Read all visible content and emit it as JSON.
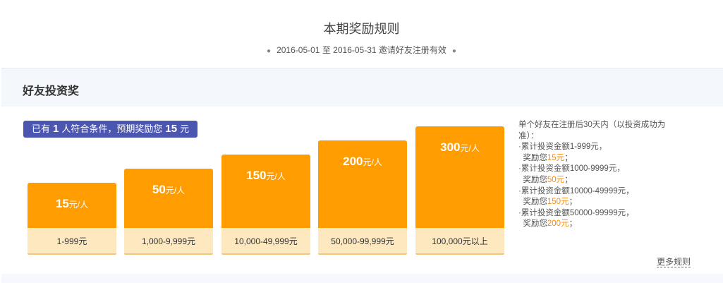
{
  "header": {
    "title": "本期奖励规则",
    "period_start": "2016-05-01",
    "period_sep": "至",
    "period_end": "2016-05-31",
    "period_note": "邀请好友注册有效"
  },
  "section": {
    "title": "好友投资奖",
    "summary_prefix": "已有",
    "summary_count": "1",
    "summary_mid": "人符合条件，预期奖励您",
    "summary_amount": "15",
    "summary_suffix": "元"
  },
  "tiers": [
    {
      "reward": "15",
      "unit": "元/人",
      "range": "1-999元"
    },
    {
      "reward": "50",
      "unit": "元/人",
      "range": "1,000-9,999元"
    },
    {
      "reward": "150",
      "unit": "元/人",
      "range": "10,000-49,999元"
    },
    {
      "reward": "200",
      "unit": "元/人",
      "range": "50,000-99,999元"
    },
    {
      "reward": "300",
      "unit": "元/人",
      "range": "100,000元以上"
    }
  ],
  "rules": {
    "intro_1": "单个好友在注册后30天内（以投资成功为",
    "intro_2": "准）：",
    "items": [
      {
        "cond": "·累计投资金额1-999元，",
        "prefix": "奖励您",
        "amount": "15元",
        "suffix": "；"
      },
      {
        "cond": "·累计投资金额1000-9999元，",
        "prefix": "奖励您",
        "amount": "50元",
        "suffix": "；"
      },
      {
        "cond": "·累计投资金额10000-49999元，",
        "prefix": "奖励您",
        "amount": "150元",
        "suffix": "；"
      },
      {
        "cond": "·累计投资金额50000-99999元，",
        "prefix": "奖励您",
        "amount": "200元",
        "suffix": "；"
      }
    ],
    "more": "更多规则"
  },
  "colors": {
    "bar": "#ff9c00",
    "range_bg": "#fee8c0",
    "summary_bg": "#4a56b0",
    "highlight": "#ff8a00"
  }
}
